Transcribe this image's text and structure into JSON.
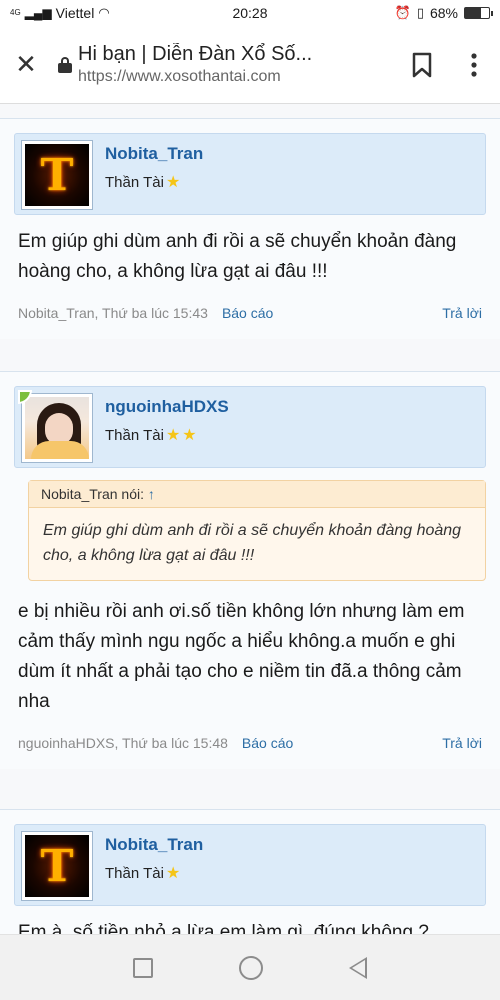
{
  "status_bar": {
    "network": "4G",
    "carrier": "Viettel",
    "time": "20:28",
    "battery": "68%",
    "battery_level": 0.68
  },
  "browser": {
    "page_title": "Hi bạn | Diễn Đàn Xổ Số...",
    "url": "https://www.xosothantai.com"
  },
  "posts": [
    {
      "username": "Nobita_Tran",
      "user_title": "Thần Tài",
      "stars": 1,
      "avatar_letter": "T",
      "message": "Em giúp ghi dùm anh đi rồi a sẽ chuyển khoản đàng hoàng cho, a không lừa gạt ai đâu !!!",
      "meta": "Nobita_Tran, Thứ ba lúc 15:43",
      "report_label": "Báo cáo",
      "reply_label": "Trả lời"
    },
    {
      "username": "nguoinhaHDXS",
      "user_title": "Thần Tài",
      "stars": 2,
      "quote_author": "Nobita_Tran nói:",
      "quote_arrow": "↑",
      "quote_text": "Em giúp ghi dùm anh đi rồi a sẽ chuyển khoản đàng hoàng cho, a không lừa gạt ai đâu !!!",
      "message": "e bị nhiều rồi anh ơi.số tiền không lớn nhưng làm em cảm thấy mình ngu ngốc a hiểu không.a muốn e ghi dùm ít nhất a phải tạo cho e niềm tin đã.a thông cảm nha",
      "meta": "nguoinhaHDXS, Thứ ba lúc 15:48",
      "report_label": "Báo cáo",
      "reply_label": "Trả lời"
    },
    {
      "username": "Nobita_Tran",
      "user_title": "Thần Tài",
      "stars": 1,
      "avatar_letter": "T",
      "message": "Em à, số tiền nhỏ a lừa em làm gì, đúng không ?"
    }
  ],
  "icons": {
    "close": "close-icon",
    "lock": "lock-icon",
    "bookmark": "bookmark-icon",
    "menu": "more-vert-icon",
    "star": "★"
  },
  "colors": {
    "username": "#1f5fa0",
    "header_bg": "#dcebf9",
    "link": "#2d6ea5",
    "quote_bg": "#fff7ec"
  }
}
